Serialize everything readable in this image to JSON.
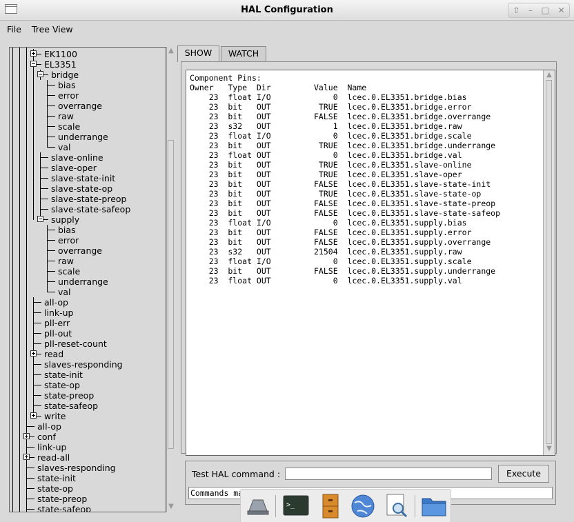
{
  "window": {
    "title": "HAL Configuration"
  },
  "menubar": {
    "items": [
      "File",
      "Tree View"
    ]
  },
  "tree": [
    {
      "label": "EK1100",
      "depth": 2,
      "expander": "plus",
      "last": false
    },
    {
      "label": "EL3351",
      "depth": 2,
      "expander": "minus",
      "last": false
    },
    {
      "label": "bridge",
      "depth": 3,
      "expander": "minus",
      "last": false
    },
    {
      "label": "bias",
      "depth": 4,
      "last": false
    },
    {
      "label": "error",
      "depth": 4,
      "last": false
    },
    {
      "label": "overrange",
      "depth": 4,
      "last": false
    },
    {
      "label": "raw",
      "depth": 4,
      "last": false
    },
    {
      "label": "scale",
      "depth": 4,
      "last": false
    },
    {
      "label": "underrange",
      "depth": 4,
      "last": false
    },
    {
      "label": "val",
      "depth": 4,
      "last": true
    },
    {
      "label": "slave-online",
      "depth": 3,
      "last": false
    },
    {
      "label": "slave-oper",
      "depth": 3,
      "last": false
    },
    {
      "label": "slave-state-init",
      "depth": 3,
      "last": false
    },
    {
      "label": "slave-state-op",
      "depth": 3,
      "last": false
    },
    {
      "label": "slave-state-preop",
      "depth": 3,
      "last": false
    },
    {
      "label": "slave-state-safeop",
      "depth": 3,
      "last": false
    },
    {
      "label": "supply",
      "depth": 3,
      "expander": "minus",
      "last": true
    },
    {
      "label": "bias",
      "depth": 4,
      "last": false
    },
    {
      "label": "error",
      "depth": 4,
      "last": false
    },
    {
      "label": "overrange",
      "depth": 4,
      "last": false
    },
    {
      "label": "raw",
      "depth": 4,
      "last": false
    },
    {
      "label": "scale",
      "depth": 4,
      "last": false
    },
    {
      "label": "underrange",
      "depth": 4,
      "last": false
    },
    {
      "label": "val",
      "depth": 4,
      "last": true
    },
    {
      "label": "all-op",
      "depth": 2,
      "last": false
    },
    {
      "label": "link-up",
      "depth": 2,
      "last": false
    },
    {
      "label": "pll-err",
      "depth": 2,
      "last": false
    },
    {
      "label": "pll-out",
      "depth": 2,
      "last": false
    },
    {
      "label": "pll-reset-count",
      "depth": 2,
      "last": false
    },
    {
      "label": "read",
      "depth": 2,
      "expander": "plus",
      "last": false
    },
    {
      "label": "slaves-responding",
      "depth": 2,
      "last": false
    },
    {
      "label": "state-init",
      "depth": 2,
      "last": false
    },
    {
      "label": "state-op",
      "depth": 2,
      "last": false
    },
    {
      "label": "state-preop",
      "depth": 2,
      "last": false
    },
    {
      "label": "state-safeop",
      "depth": 2,
      "last": false
    },
    {
      "label": "write",
      "depth": 2,
      "expander": "plus",
      "last": true
    },
    {
      "label": "all-op",
      "depth": 1,
      "last": false
    },
    {
      "label": "conf",
      "depth": 1,
      "expander": "plus",
      "last": false
    },
    {
      "label": "link-up",
      "depth": 1,
      "last": false
    },
    {
      "label": "read-all",
      "depth": 1,
      "expander": "plus",
      "last": false
    },
    {
      "label": "slaves-responding",
      "depth": 1,
      "last": false
    },
    {
      "label": "state-init",
      "depth": 1,
      "last": false
    },
    {
      "label": "state-op",
      "depth": 1,
      "last": false
    },
    {
      "label": "state-preop",
      "depth": 1,
      "last": false
    },
    {
      "label": "state-safeop",
      "depth": 1,
      "last": false
    }
  ],
  "tabs": [
    {
      "label": "SHOW",
      "active": true
    },
    {
      "label": "WATCH",
      "active": false
    }
  ],
  "pins": {
    "heading": "Component Pins:",
    "columns": [
      "Owner",
      "Type",
      "Dir",
      "Value",
      "Name"
    ],
    "rows": [
      [
        "23",
        "float",
        "I/O",
        "0",
        "lcec.0.EL3351.bridge.bias"
      ],
      [
        "23",
        "bit",
        "OUT",
        "TRUE",
        "lcec.0.EL3351.bridge.error"
      ],
      [
        "23",
        "bit",
        "OUT",
        "FALSE",
        "lcec.0.EL3351.bridge.overrange"
      ],
      [
        "23",
        "s32",
        "OUT",
        "1",
        "lcec.0.EL3351.bridge.raw"
      ],
      [
        "23",
        "float",
        "I/O",
        "0",
        "lcec.0.EL3351.bridge.scale"
      ],
      [
        "23",
        "bit",
        "OUT",
        "TRUE",
        "lcec.0.EL3351.bridge.underrange"
      ],
      [
        "23",
        "float",
        "OUT",
        "0",
        "lcec.0.EL3351.bridge.val"
      ],
      [
        "23",
        "bit",
        "OUT",
        "TRUE",
        "lcec.0.EL3351.slave-online"
      ],
      [
        "23",
        "bit",
        "OUT",
        "TRUE",
        "lcec.0.EL3351.slave-oper"
      ],
      [
        "23",
        "bit",
        "OUT",
        "FALSE",
        "lcec.0.EL3351.slave-state-init"
      ],
      [
        "23",
        "bit",
        "OUT",
        "TRUE",
        "lcec.0.EL3351.slave-state-op"
      ],
      [
        "23",
        "bit",
        "OUT",
        "FALSE",
        "lcec.0.EL3351.slave-state-preop"
      ],
      [
        "23",
        "bit",
        "OUT",
        "FALSE",
        "lcec.0.EL3351.slave-state-safeop"
      ],
      [
        "23",
        "float",
        "I/O",
        "0",
        "lcec.0.EL3351.supply.bias"
      ],
      [
        "23",
        "bit",
        "OUT",
        "FALSE",
        "lcec.0.EL3351.supply.error"
      ],
      [
        "23",
        "bit",
        "OUT",
        "FALSE",
        "lcec.0.EL3351.supply.overrange"
      ],
      [
        "23",
        "s32",
        "OUT",
        "21504",
        "lcec.0.EL3351.supply.raw"
      ],
      [
        "23",
        "float",
        "I/O",
        "0",
        "lcec.0.EL3351.supply.scale"
      ],
      [
        "23",
        "bit",
        "OUT",
        "FALSE",
        "lcec.0.EL3351.supply.underrange"
      ],
      [
        "23",
        "float",
        "OUT",
        "0",
        "lcec.0.EL3351.supply.val"
      ]
    ]
  },
  "command": {
    "label": "Test HAL command :",
    "value": "",
    "execute_label": "Execute",
    "status_text": "Commands ma"
  },
  "dock": {
    "items": [
      "drive-icon",
      "terminal-icon",
      "file-cabinet-icon",
      "globe-icon",
      "document-search-icon",
      "folder-icon"
    ]
  }
}
